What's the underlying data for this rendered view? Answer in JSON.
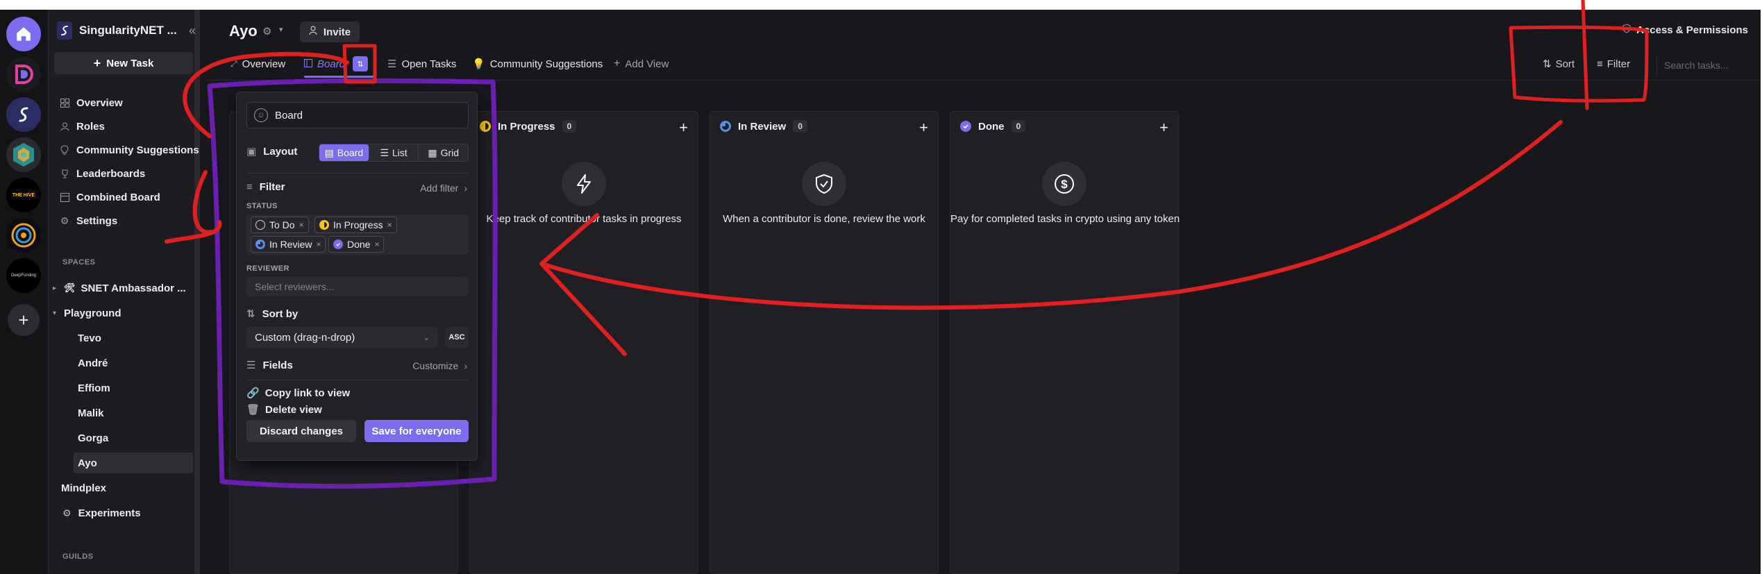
{
  "rail": {
    "items": [
      {
        "icon": "home-icon",
        "color": "#7c6cf0"
      },
      {
        "icon": "d-logo-icon",
        "color": "#e040a0"
      },
      {
        "icon": "singularitynet-logo-icon",
        "color": "#3b3b9c"
      },
      {
        "icon": "hexagon-logo-icon",
        "color": "#2aa0a0"
      },
      {
        "icon": "the-hive-logo-icon",
        "color": "#000000",
        "label": "THE HIVE"
      },
      {
        "icon": "ring-logo-icon",
        "color": "#f0a020"
      },
      {
        "icon": "deep-funding-logo-icon",
        "color": "#000000",
        "label": "DeepFunding"
      },
      {
        "icon": "plus-icon",
        "color": "#2c2c33"
      }
    ]
  },
  "sidebar": {
    "title": "SingularityNET ...",
    "new_task": "New Task",
    "nav": [
      {
        "label": "Overview",
        "icon": "grid-icon"
      },
      {
        "label": "Roles",
        "icon": "roles-icon"
      },
      {
        "label": "Community Suggestions",
        "icon": "bulb-icon"
      },
      {
        "label": "Leaderboards",
        "icon": "trophy-icon"
      },
      {
        "label": "Combined Board",
        "icon": "board-icon"
      },
      {
        "label": "Settings",
        "icon": "gear-icon"
      }
    ],
    "spaces_label": "SPACES",
    "spaces": [
      {
        "label": "SNET Ambassador ...",
        "icon": "tools-icon"
      },
      {
        "label": "Playground"
      },
      {
        "label": "Tevo"
      },
      {
        "label": "André"
      },
      {
        "label": "Effiom"
      },
      {
        "label": "Malik"
      },
      {
        "label": "Gorga"
      },
      {
        "label": "Ayo"
      },
      {
        "label": "Mindplex"
      },
      {
        "label": "Experiments",
        "icon": "gear-icon"
      }
    ],
    "guilds_label": "GUILDS"
  },
  "header": {
    "title": "Ayo",
    "invite": "Invite",
    "access": "Access & Permissions",
    "tabs": [
      "Overview",
      "Board",
      "Open Tasks",
      "Community Suggestions",
      "Add View"
    ],
    "sort": "Sort",
    "filter": "Filter",
    "search_placeholder": "Search tasks..."
  },
  "columns": [
    {
      "name": "In Progress",
      "count": "0",
      "text": "Keep track of contributor tasks in progress",
      "status_color": "#f5c518",
      "icon": "lightning-icon"
    },
    {
      "name": "In Review",
      "count": "0",
      "text": "When a contributor is done, review the work",
      "status_color": "#5b8def",
      "icon": "shield-check-icon"
    },
    {
      "name": "Done",
      "count": "0",
      "text": "Pay for completed tasks in crypto using any token",
      "status_color": "#7c6cf0",
      "icon": "dollar-icon"
    }
  ],
  "popover": {
    "view_name": "Board",
    "layout_label": "Layout",
    "layouts": [
      "Board",
      "List",
      "Grid"
    ],
    "filter_label": "Filter",
    "add_filter": "Add filter",
    "status_label": "STATUS",
    "statuses": [
      "To Do",
      "In Progress",
      "In Review",
      "Done"
    ],
    "reviewer_label": "REVIEWER",
    "reviewer_placeholder": "Select reviewers...",
    "sort_label": "Sort by",
    "sort_value": "Custom (drag-n-drop)",
    "sort_dir": "ASC",
    "fields_label": "Fields",
    "customize": "Customize",
    "copy_link": "Copy link to view",
    "delete_view": "Delete view",
    "discard": "Discard changes",
    "save": "Save for everyone"
  },
  "colors": {
    "accent": "#7c6cf0",
    "annotation_red": "#e0201e",
    "annotation_purple": "#6a1fb0"
  }
}
